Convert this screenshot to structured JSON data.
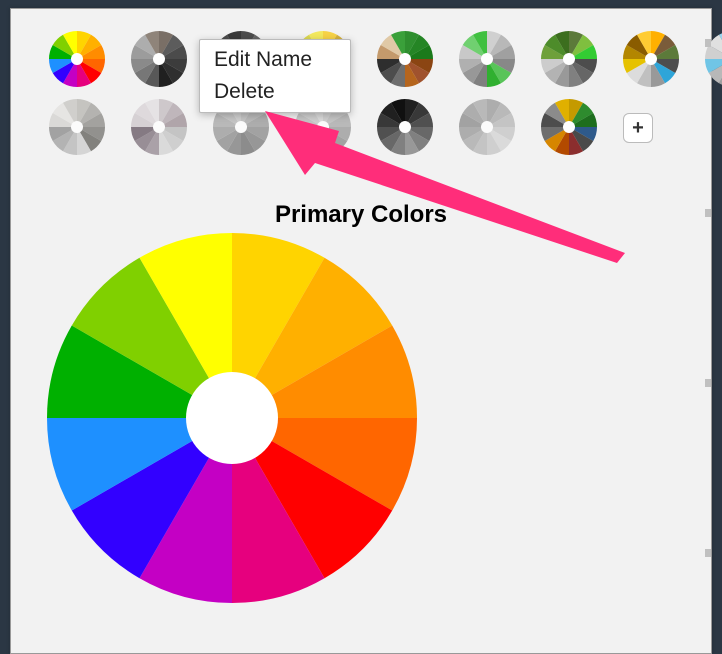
{
  "context_menu": {
    "edit_name": "Edit Name",
    "delete": "Delete"
  },
  "title": "Primary Colors",
  "add_label": "+",
  "wheel_colors": [
    "#ffd400",
    "#ffb000",
    "#ff8c00",
    "#ff6600",
    "#ff0000",
    "#e6007e",
    "#c400c4",
    "#3200ff",
    "#1e90ff",
    "#00b000",
    "#80d000",
    "#ffff00"
  ],
  "thumbnails": {
    "row1": [
      {
        "name": "thumb-0",
        "grey": false,
        "colors": [
          "#ffd400",
          "#ffb000",
          "#ff8c00",
          "#ff6600",
          "#ff0000",
          "#e6007e",
          "#c400c4",
          "#3200ff",
          "#1e90ff",
          "#00b000",
          "#80d000",
          "#ffff00"
        ]
      },
      {
        "name": "thumb-1",
        "grey": false,
        "colors": [
          "#7a6f66",
          "#5c5c5c",
          "#4b4b4b",
          "#3c3c3c",
          "#2f2f2f",
          "#202020",
          "#585858",
          "#777777",
          "#8a8a8a",
          "#9c9c9c",
          "#adadad",
          "#8f847a"
        ]
      },
      {
        "name": "thumb-2",
        "grey": false,
        "colors": [
          "#4d4d4d",
          "#666666",
          "#7a7a7a",
          "#8e8e8e",
          "#a0a0a0",
          "#b0b0b0",
          "#9c9c9c",
          "#888888",
          "#747474",
          "#606060",
          "#4c4c4c",
          "#3a3a3a"
        ]
      },
      {
        "name": "thumb-3",
        "grey": false,
        "colors": [
          "#f7d347",
          "#d6b23c",
          "#b5912f",
          "#946f22",
          "#734e16",
          "#533e0c",
          "#6e5d1a",
          "#8a7c28",
          "#a59b36",
          "#c0ba44",
          "#dcd952",
          "#f3e95e"
        ]
      },
      {
        "name": "thumb-4",
        "grey": false,
        "colors": [
          "#2f8f2f",
          "#258525",
          "#1b7a1b",
          "#8b4513",
          "#a0522d",
          "#b5651d",
          "#6e6e6e",
          "#4d4d4d",
          "#2e2e2e",
          "#c49a6c",
          "#e0c9a6",
          "#3aa03a"
        ]
      },
      {
        "name": "thumb-5",
        "grey": false,
        "colors": [
          "#d0d0d0",
          "#b8b8b8",
          "#a0a0a0",
          "#888888",
          "#58c458",
          "#30b030",
          "#808080",
          "#989898",
          "#b0b0b0",
          "#c8c8c8",
          "#70d070",
          "#40c040"
        ]
      },
      {
        "name": "thumb-6",
        "grey": false,
        "colors": [
          "#5c7a3a",
          "#7fbf3f",
          "#33cc33",
          "#4d4d4d",
          "#666666",
          "#808080",
          "#999999",
          "#b3b3b3",
          "#cccccc",
          "#6ea03a",
          "#4d8c2a",
          "#3c6e1e"
        ]
      },
      {
        "name": "thumb-7",
        "grey": false,
        "colors": [
          "#ffb000",
          "#7a5c3a",
          "#5c7a3a",
          "#4d4d4d",
          "#2ea5d9",
          "#999999",
          "#c0c0c0",
          "#dcdcdc",
          "#e6c200",
          "#b38600",
          "#8a5c00",
          "#ffcc33"
        ]
      },
      {
        "name": "thumb-8",
        "grey": false,
        "colors": [
          "#b0b0b0",
          "#c8c8c8",
          "#4db8e6",
          "#2ea5d9",
          "#1a8cc0",
          "#888888",
          "#a0a0a0",
          "#b8b8b8",
          "#70c5e6",
          "#d0d0d0",
          "#e0e0e0",
          "#98d5ee"
        ]
      }
    ],
    "row2": [
      {
        "name": "thumb-9",
        "grey": true,
        "colors": [
          "#c0b080",
          "#a89868",
          "#908050",
          "#786838",
          "#605020",
          "#c8c8c8",
          "#b0b0b0",
          "#989898",
          "#808080",
          "#d8d0a8",
          "#e8e0c0",
          "#d0c090"
        ]
      },
      {
        "name": "thumb-10",
        "grey": true,
        "colors": [
          "#ffa0d0",
          "#ff80c0",
          "#ff60b0",
          "#b0b0b0",
          "#c0c0c0",
          "#d0d0d0",
          "#e060c0",
          "#d040b0",
          "#c020a0",
          "#ffb0e0",
          "#ffc0e8",
          "#ffd0f0"
        ]
      },
      {
        "name": "thumb-11",
        "grey": true,
        "colors": [
          "#b0b0b0",
          "#a0a0a0",
          "#909090",
          "#808080",
          "#707070",
          "#606060",
          "#707070",
          "#808080",
          "#909090",
          "#a0a0a0",
          "#b0b0b0",
          "#c0c0c0"
        ]
      },
      {
        "name": "thumb-12",
        "grey": true,
        "colors": [
          "#c0c0c0",
          "#b0b0b0",
          "#a0a0a0",
          "#909090",
          "#808080",
          "#707070",
          "#808080",
          "#909090",
          "#a0a0a0",
          "#b0b0b0",
          "#c0c0c0",
          "#d0d0d0"
        ]
      },
      {
        "name": "thumb-13",
        "grey": false,
        "colors": [
          "#202020",
          "#383838",
          "#505050",
          "#686868",
          "#808080",
          "#989898",
          "#808080",
          "#686868",
          "#505050",
          "#383838",
          "#202020",
          "#101010"
        ]
      },
      {
        "name": "thumb-14",
        "grey": true,
        "colors": [
          "#909090",
          "#a0a0a0",
          "#b0b0b0",
          "#c0c0c0",
          "#d0d0d0",
          "#c0c0c0",
          "#b0b0b0",
          "#a0a0a0",
          "#909090",
          "#808080",
          "#909090",
          "#a0a0a0"
        ]
      },
      {
        "name": "thumb-15",
        "grey": false,
        "colors": [
          "#c49a00",
          "#2e8b2e",
          "#1e6e1e",
          "#2e5a8b",
          "#4a4a4a",
          "#8b2e2e",
          "#b34a00",
          "#d68600",
          "#6e6e6e",
          "#4d4d4d",
          "#8b8b8b",
          "#e0b000"
        ]
      }
    ]
  },
  "annotation": {
    "color": "#ff2d7a"
  }
}
